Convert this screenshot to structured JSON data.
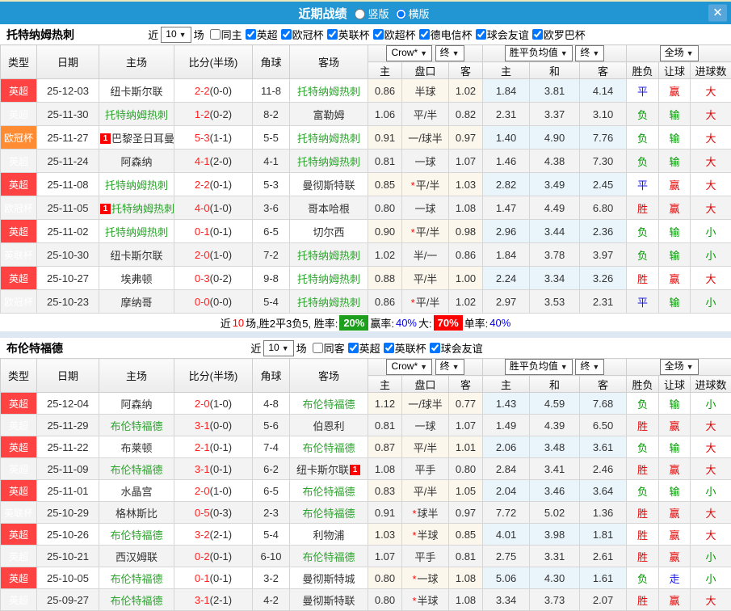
{
  "topbar": {
    "title": "近期战绩",
    "layout_options": [
      {
        "label": "竖版",
        "checked": false
      },
      {
        "label": "横版",
        "checked": true
      }
    ],
    "close_glyph": "✕"
  },
  "icons": {
    "select_arrow": "▼",
    "marker_glyph": "1",
    "star_glyph": "*"
  },
  "colors": {
    "header_blue": "#2196d3",
    "epl_red": "#ff4242",
    "ucl_orange": "#ff8c33",
    "cup_gray": "#9b9b9b",
    "team_green": "#2ba52b",
    "score_red": "#ff2222",
    "win_red": "#e60000",
    "lose_green": "#009900",
    "draw_blue": "#1a1ae6",
    "asia_bg": "#fcf7ec",
    "euro_bg": "#eaf5fb",
    "rate_green_bg": "#1d9e1d",
    "rate_red_bg": "#ff0000"
  },
  "table_header": {
    "type": "类型",
    "date": "日期",
    "home": "主场",
    "score": "比分(半场)",
    "corner": "角球",
    "away": "客场",
    "book_select": "Crow*",
    "final_select": "终",
    "avg_select": "胜平负均值",
    "avg_final_select": "终",
    "scope_select": "全场",
    "sub_asia_home": "主",
    "sub_asia_handicap": "盘口",
    "sub_asia_away": "客",
    "sub_euro_home": "主",
    "sub_euro_draw": "和",
    "sub_euro_away": "客",
    "sub_outcome": "胜负",
    "sub_handicap": "让球",
    "sub_goals": "进球数"
  },
  "sections": [
    {
      "team": "托特纳姆热刺",
      "filter": {
        "near": "近",
        "count": "10",
        "games": "场",
        "same": {
          "label": "同主",
          "checked": false
        },
        "leagues": [
          {
            "label": "英超",
            "checked": true
          },
          {
            "label": "欧冠杯",
            "checked": true
          },
          {
            "label": "英联杯",
            "checked": true
          },
          {
            "label": "欧超杯",
            "checked": true
          },
          {
            "label": "德电信杯",
            "checked": true
          },
          {
            "label": "球会友谊",
            "checked": true
          },
          {
            "label": "欧罗巴杯",
            "checked": true
          }
        ]
      },
      "rows": [
        {
          "league": "英超",
          "date": "25-12-03",
          "home": "纽卡斯尔联",
          "home_green": false,
          "home_mark": "",
          "score": "2-2",
          "half": "(0-0)",
          "corners": "11-8",
          "away": "托特纳姆热刺",
          "away_green": true,
          "away_mark": "",
          "asia_home": "0.86",
          "asia_star": false,
          "asia_handicap": "半球",
          "asia_away": "1.02",
          "euro_home": "1.84",
          "euro_draw": "3.81",
          "euro_away": "4.14",
          "outcome": "平",
          "handicap_result": "赢",
          "goals_result": "大"
        },
        {
          "league": "英超",
          "date": "25-11-30",
          "home": "托特纳姆热刺",
          "home_green": true,
          "home_mark": "",
          "score": "1-2",
          "half": "(0-2)",
          "corners": "8-2",
          "away": "富勒姆",
          "away_green": false,
          "away_mark": "",
          "asia_home": "1.06",
          "asia_star": false,
          "asia_handicap": "平/半",
          "asia_away": "0.82",
          "euro_home": "2.31",
          "euro_draw": "3.37",
          "euro_away": "3.10",
          "outcome": "负",
          "handicap_result": "输",
          "goals_result": "大"
        },
        {
          "league": "欧冠杯",
          "date": "25-11-27",
          "home": "巴黎圣日耳曼",
          "home_green": false,
          "home_mark": "pre",
          "score": "5-3",
          "half": "(1-1)",
          "corners": "5-5",
          "away": "托特纳姆热刺",
          "away_green": true,
          "away_mark": "",
          "asia_home": "0.91",
          "asia_star": false,
          "asia_handicap": "一/球半",
          "asia_away": "0.97",
          "euro_home": "1.40",
          "euro_draw": "4.90",
          "euro_away": "7.76",
          "outcome": "负",
          "handicap_result": "输",
          "goals_result": "大"
        },
        {
          "league": "英超",
          "date": "25-11-24",
          "home": "阿森纳",
          "home_green": false,
          "home_mark": "",
          "score": "4-1",
          "half": "(2-0)",
          "corners": "4-1",
          "away": "托特纳姆热刺",
          "away_green": true,
          "away_mark": "",
          "asia_home": "0.81",
          "asia_star": false,
          "asia_handicap": "一球",
          "asia_away": "1.07",
          "euro_home": "1.46",
          "euro_draw": "4.38",
          "euro_away": "7.30",
          "outcome": "负",
          "handicap_result": "输",
          "goals_result": "大"
        },
        {
          "league": "英超",
          "date": "25-11-08",
          "home": "托特纳姆热刺",
          "home_green": true,
          "home_mark": "",
          "score": "2-2",
          "half": "(0-1)",
          "corners": "5-3",
          "away": "曼彻斯特联",
          "away_green": false,
          "away_mark": "",
          "asia_home": "0.85",
          "asia_star": true,
          "asia_handicap": "平/半",
          "asia_away": "1.03",
          "euro_home": "2.82",
          "euro_draw": "3.49",
          "euro_away": "2.45",
          "outcome": "平",
          "handicap_result": "赢",
          "goals_result": "大"
        },
        {
          "league": "欧冠杯",
          "date": "25-11-05",
          "home": "托特纳姆热刺",
          "home_green": true,
          "home_mark": "pre",
          "score": "4-0",
          "half": "(1-0)",
          "corners": "3-6",
          "away": "哥本哈根",
          "away_green": false,
          "away_mark": "",
          "asia_home": "0.80",
          "asia_star": false,
          "asia_handicap": "一球",
          "asia_away": "1.08",
          "euro_home": "1.47",
          "euro_draw": "4.49",
          "euro_away": "6.80",
          "outcome": "胜",
          "handicap_result": "赢",
          "goals_result": "大"
        },
        {
          "league": "英超",
          "date": "25-11-02",
          "home": "托特纳姆热刺",
          "home_green": true,
          "home_mark": "",
          "score": "0-1",
          "half": "(0-1)",
          "corners": "6-5",
          "away": "切尔西",
          "away_green": false,
          "away_mark": "",
          "asia_home": "0.90",
          "asia_star": true,
          "asia_handicap": "平/半",
          "asia_away": "0.98",
          "euro_home": "2.96",
          "euro_draw": "3.44",
          "euro_away": "2.36",
          "outcome": "负",
          "handicap_result": "输",
          "goals_result": "小"
        },
        {
          "league": "英联杯",
          "date": "25-10-30",
          "home": "纽卡斯尔联",
          "home_green": false,
          "home_mark": "",
          "score": "2-0",
          "half": "(1-0)",
          "corners": "7-2",
          "away": "托特纳姆热刺",
          "away_green": true,
          "away_mark": "",
          "asia_home": "1.02",
          "asia_star": false,
          "asia_handicap": "半/一",
          "asia_away": "0.86",
          "euro_home": "1.84",
          "euro_draw": "3.78",
          "euro_away": "3.97",
          "outcome": "负",
          "handicap_result": "输",
          "goals_result": "小"
        },
        {
          "league": "英超",
          "date": "25-10-27",
          "home": "埃弗顿",
          "home_green": false,
          "home_mark": "",
          "score": "0-3",
          "half": "(0-2)",
          "corners": "9-8",
          "away": "托特纳姆热刺",
          "away_green": true,
          "away_mark": "",
          "asia_home": "0.88",
          "asia_star": false,
          "asia_handicap": "平/半",
          "asia_away": "1.00",
          "euro_home": "2.24",
          "euro_draw": "3.34",
          "euro_away": "3.26",
          "outcome": "胜",
          "handicap_result": "赢",
          "goals_result": "大"
        },
        {
          "league": "欧冠杯",
          "date": "25-10-23",
          "home": "摩纳哥",
          "home_green": false,
          "home_mark": "",
          "score": "0-0",
          "half": "(0-0)",
          "corners": "5-4",
          "away": "托特纳姆热刺",
          "away_green": true,
          "away_mark": "",
          "asia_home": "0.86",
          "asia_star": true,
          "asia_handicap": "平/半",
          "asia_away": "1.02",
          "euro_home": "2.97",
          "euro_draw": "3.53",
          "euro_away": "2.31",
          "outcome": "平",
          "handicap_result": "输",
          "goals_result": "小"
        }
      ],
      "summary": {
        "near": "近",
        "count": "10",
        "stats": "场,胜2平3负5, 胜率:",
        "win_rate": "20%",
        "odds_label": "赢率:",
        "odds_rate": "40%",
        "big_label": "大:",
        "big_rate": "70%",
        "single_label": "单率:",
        "single_rate": "40%"
      }
    },
    {
      "team": "布伦特福德",
      "filter": {
        "near": "近",
        "count": "10",
        "games": "场",
        "same": {
          "label": "同客",
          "checked": false
        },
        "leagues": [
          {
            "label": "英超",
            "checked": true
          },
          {
            "label": "英联杯",
            "checked": true
          },
          {
            "label": "球会友谊",
            "checked": true
          }
        ]
      },
      "rows": [
        {
          "league": "英超",
          "date": "25-12-04",
          "home": "阿森纳",
          "home_green": false,
          "home_mark": "",
          "score": "2-0",
          "half": "(1-0)",
          "corners": "4-8",
          "away": "布伦特福德",
          "away_green": true,
          "away_mark": "",
          "asia_home": "1.12",
          "asia_star": false,
          "asia_handicap": "一/球半",
          "asia_away": "0.77",
          "euro_home": "1.43",
          "euro_draw": "4.59",
          "euro_away": "7.68",
          "outcome": "负",
          "handicap_result": "输",
          "goals_result": "小"
        },
        {
          "league": "英超",
          "date": "25-11-29",
          "home": "布伦特福德",
          "home_green": true,
          "home_mark": "",
          "score": "3-1",
          "half": "(0-0)",
          "corners": "5-6",
          "away": "伯恩利",
          "away_green": false,
          "away_mark": "",
          "asia_home": "0.81",
          "asia_star": false,
          "asia_handicap": "一球",
          "asia_away": "1.07",
          "euro_home": "1.49",
          "euro_draw": "4.39",
          "euro_away": "6.50",
          "outcome": "胜",
          "handicap_result": "赢",
          "goals_result": "大"
        },
        {
          "league": "英超",
          "date": "25-11-22",
          "home": "布莱顿",
          "home_green": false,
          "home_mark": "",
          "score": "2-1",
          "half": "(0-1)",
          "corners": "7-4",
          "away": "布伦特福德",
          "away_green": true,
          "away_mark": "",
          "asia_home": "0.87",
          "asia_star": false,
          "asia_handicap": "平/半",
          "asia_away": "1.01",
          "euro_home": "2.06",
          "euro_draw": "3.48",
          "euro_away": "3.61",
          "outcome": "负",
          "handicap_result": "输",
          "goals_result": "大"
        },
        {
          "league": "英超",
          "date": "25-11-09",
          "home": "布伦特福德",
          "home_green": true,
          "home_mark": "",
          "score": "3-1",
          "half": "(0-1)",
          "corners": "6-2",
          "away": "纽卡斯尔联",
          "away_green": false,
          "away_mark": "post",
          "asia_home": "1.08",
          "asia_star": false,
          "asia_handicap": "平手",
          "asia_away": "0.80",
          "euro_home": "2.84",
          "euro_draw": "3.41",
          "euro_away": "2.46",
          "outcome": "胜",
          "handicap_result": "赢",
          "goals_result": "大"
        },
        {
          "league": "英超",
          "date": "25-11-01",
          "home": "水晶宫",
          "home_green": false,
          "home_mark": "",
          "score": "2-0",
          "half": "(1-0)",
          "corners": "6-5",
          "away": "布伦特福德",
          "away_green": true,
          "away_mark": "",
          "asia_home": "0.83",
          "asia_star": false,
          "asia_handicap": "平/半",
          "asia_away": "1.05",
          "euro_home": "2.04",
          "euro_draw": "3.46",
          "euro_away": "3.64",
          "outcome": "负",
          "handicap_result": "输",
          "goals_result": "小"
        },
        {
          "league": "英联杯",
          "date": "25-10-29",
          "home": "格林斯比",
          "home_green": false,
          "home_mark": "",
          "score": "0-5",
          "half": "(0-3)",
          "corners": "2-3",
          "away": "布伦特福德",
          "away_green": true,
          "away_mark": "",
          "asia_home": "0.91",
          "asia_star": true,
          "asia_handicap": "球半",
          "asia_away": "0.97",
          "euro_home": "7.72",
          "euro_draw": "5.02",
          "euro_away": "1.36",
          "outcome": "胜",
          "handicap_result": "赢",
          "goals_result": "大"
        },
        {
          "league": "英超",
          "date": "25-10-26",
          "home": "布伦特福德",
          "home_green": true,
          "home_mark": "",
          "score": "3-2",
          "half": "(2-1)",
          "corners": "5-4",
          "away": "利物浦",
          "away_green": false,
          "away_mark": "",
          "asia_home": "1.03",
          "asia_star": true,
          "asia_handicap": "半球",
          "asia_away": "0.85",
          "euro_home": "4.01",
          "euro_draw": "3.98",
          "euro_away": "1.81",
          "outcome": "胜",
          "handicap_result": "赢",
          "goals_result": "大"
        },
        {
          "league": "英超",
          "date": "25-10-21",
          "home": "西汉姆联",
          "home_green": false,
          "home_mark": "",
          "score": "0-2",
          "half": "(0-1)",
          "corners": "6-10",
          "away": "布伦特福德",
          "away_green": true,
          "away_mark": "",
          "asia_home": "1.07",
          "asia_star": false,
          "asia_handicap": "平手",
          "asia_away": "0.81",
          "euro_home": "2.75",
          "euro_draw": "3.31",
          "euro_away": "2.61",
          "outcome": "胜",
          "handicap_result": "赢",
          "goals_result": "小"
        },
        {
          "league": "英超",
          "date": "25-10-05",
          "home": "布伦特福德",
          "home_green": true,
          "home_mark": "",
          "score": "0-1",
          "half": "(0-1)",
          "corners": "3-2",
          "away": "曼彻斯特城",
          "away_green": false,
          "away_mark": "",
          "asia_home": "0.80",
          "asia_star": true,
          "asia_handicap": "一球",
          "asia_away": "1.08",
          "euro_home": "5.06",
          "euro_draw": "4.30",
          "euro_away": "1.61",
          "outcome": "负",
          "handicap_result": "走",
          "goals_result": "小"
        },
        {
          "league": "英超",
          "date": "25-09-27",
          "home": "布伦特福德",
          "home_green": true,
          "home_mark": "",
          "score": "3-1",
          "half": "(2-1)",
          "corners": "4-2",
          "away": "曼彻斯特联",
          "away_green": false,
          "away_mark": "",
          "asia_home": "0.80",
          "asia_star": true,
          "asia_handicap": "半球",
          "asia_away": "1.08",
          "euro_home": "3.34",
          "euro_draw": "3.73",
          "euro_away": "2.07",
          "outcome": "胜",
          "handicap_result": "赢",
          "goals_result": "大"
        }
      ]
    }
  ]
}
